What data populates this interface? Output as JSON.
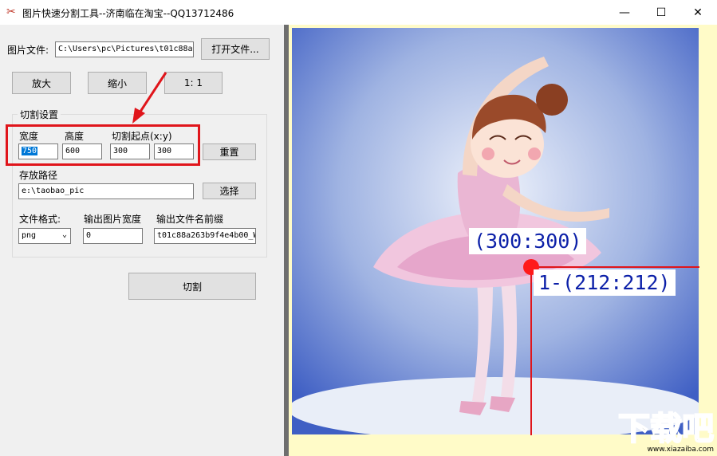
{
  "window": {
    "title": "图片快速分割工具--济南临在淘宝--QQ13712486",
    "minimize_glyph": "—",
    "maximize_glyph": "☐",
    "close_glyph": "✕",
    "icon": "scissors-icon"
  },
  "file": {
    "label": "图片文件:",
    "path": "C:\\Users\\pc\\Pictures\\t01c88a",
    "open_button": "打开文件..."
  },
  "zoom": {
    "zoom_in": "放大",
    "zoom_out": "缩小",
    "actual": "1: 1"
  },
  "cut_settings": {
    "group_title": "切割设置",
    "width_label": "宽度",
    "height_label": "高度",
    "origin_label": "切割起点(x:y)",
    "width_value": "750",
    "height_value": "600",
    "origin_x": "300",
    "origin_y": "300",
    "reset_button": "重置",
    "save_path_label": "存放路径",
    "save_path": "e:\\taobao_pic",
    "choose_button": "选择",
    "format_label": "文件格式:",
    "format_value": "png",
    "out_width_label": "输出图片宽度",
    "out_width_value": "0",
    "prefix_label": "输出文件名前缀",
    "prefix_value": "t01c88a263b9f4e4b00_W"
  },
  "cut_button": "切割",
  "preview": {
    "origin_readout": "(300:300)",
    "size_readout": "1-(212:212)",
    "marker_color": "#ff1a1a"
  },
  "watermark": {
    "text": "下载吧",
    "url": "www.xiazaiba.com"
  }
}
